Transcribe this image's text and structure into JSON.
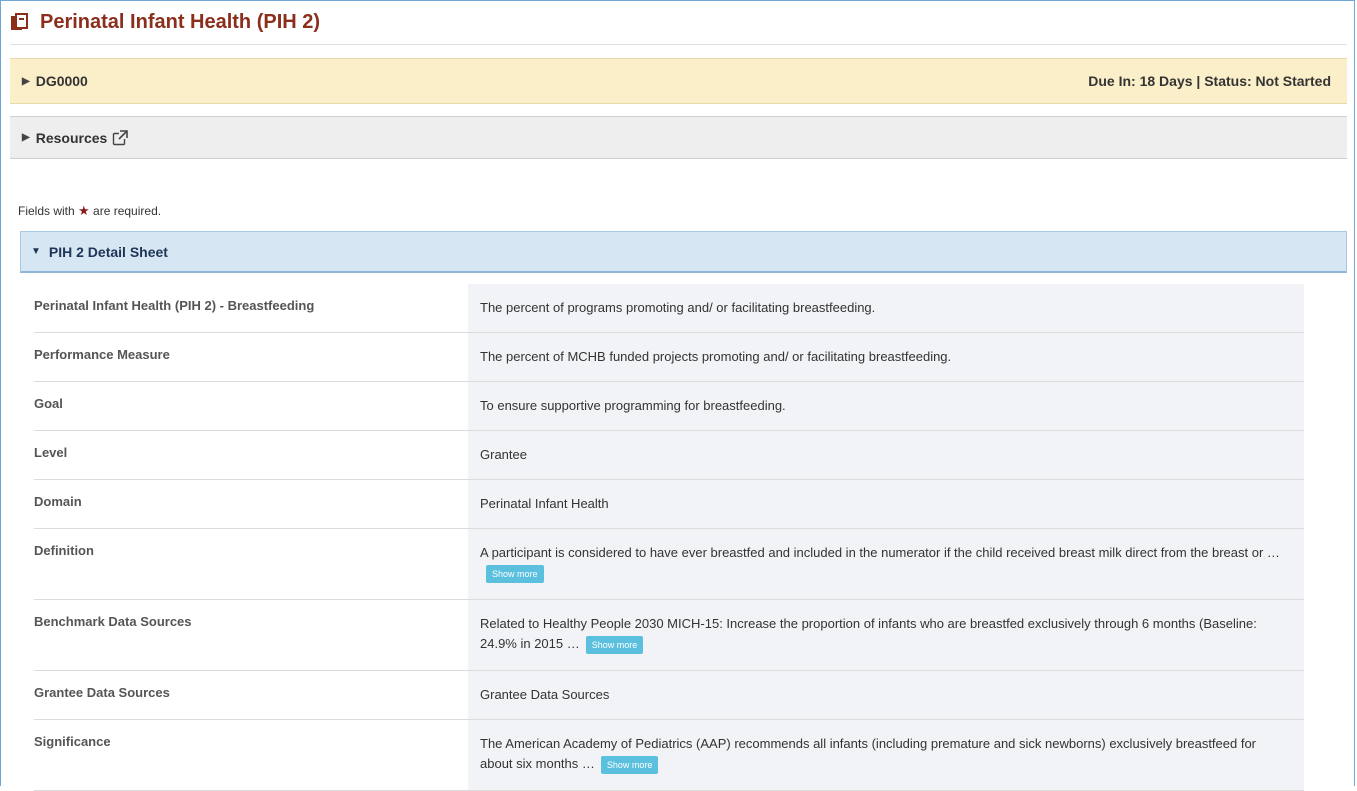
{
  "header": {
    "title": "Perinatal Infant Health (PIH 2)",
    "icon": "document-icon"
  },
  "dg_bar": {
    "label": "DG0000",
    "status_text": "Due In: 18 Days | Status: Not Started"
  },
  "resources_bar": {
    "label": "Resources"
  },
  "required_note": {
    "prefix": "Fields with",
    "suffix": "are required."
  },
  "section": {
    "title": "PIH 2 Detail Sheet"
  },
  "rows": [
    {
      "label": "Perinatal Infant Health (PIH 2) - Breastfeeding",
      "value": "The percent of programs promoting and/ or facilitating breastfeeding."
    },
    {
      "label": "Performance Measure",
      "value": "The percent of MCHB funded projects promoting and/ or facilitating breastfeeding."
    },
    {
      "label": "Goal",
      "value": "To ensure supportive programming for breastfeeding."
    },
    {
      "label": "Level",
      "value": "Grantee"
    },
    {
      "label": "Domain",
      "value": "Perinatal Infant Health"
    },
    {
      "label": "Definition",
      "value": "A participant is considered to have ever breastfed and included in the numerator if the child received breast milk direct from the breast or …",
      "more": "Show more"
    },
    {
      "label": "Benchmark Data Sources",
      "value": "Related to Healthy People 2030 MICH-15: Increase the proportion of infants who are breastfed exclusively through 6 months (Baseline: 24.9% in 2015 …",
      "more": "Show more"
    },
    {
      "label": "Grantee Data Sources",
      "value": "Grantee Data Sources"
    },
    {
      "label": "Significance",
      "value": "The American Academy of Pediatrics (AAP) recommends all infants (including premature and sick newborns) exclusively breastfeed for about six months …",
      "more": "Show more"
    }
  ],
  "colors": {
    "title": "#8b2e1c",
    "dg_bar_bg": "#fbefc9",
    "section_bg": "#d6e6f3",
    "show_more": "#5bc0de"
  }
}
